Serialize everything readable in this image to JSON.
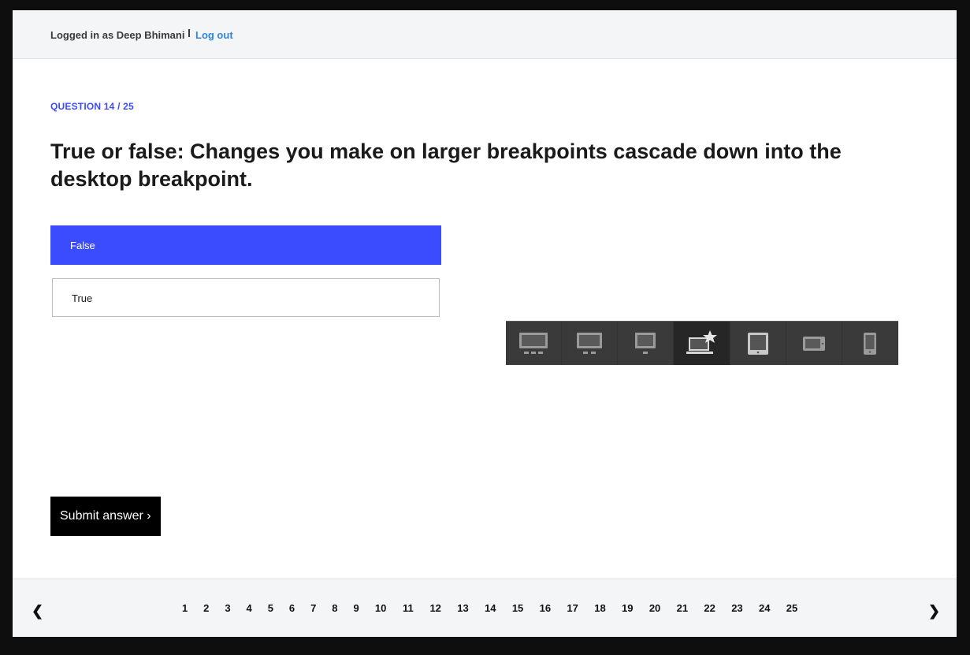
{
  "header": {
    "logged_in_text": "Logged in as Deep Bhimani",
    "logout_label": "Log out"
  },
  "quiz": {
    "counter": "QUESTION 14 / 25",
    "question": "True or false: Changes you make on larger breakpoints cascade down into the desktop breakpoint.",
    "answers": [
      {
        "label": "False",
        "selected": true
      },
      {
        "label": "True",
        "selected": false
      }
    ],
    "submit_label": "Submit answer ›"
  },
  "breakpoint_toolbar": {
    "items": [
      {
        "icon": "large-desktop-icon",
        "active": false
      },
      {
        "icon": "medium-desktop-icon",
        "active": false
      },
      {
        "icon": "small-desktop-icon",
        "active": false
      },
      {
        "icon": "desktop-base-star-icon",
        "active": true
      },
      {
        "icon": "tablet-icon",
        "active": false
      },
      {
        "icon": "mobile-landscape-icon",
        "active": false
      },
      {
        "icon": "mobile-portrait-icon",
        "active": false
      }
    ]
  },
  "pagination": {
    "prev_label": "❮",
    "next_label": "❯",
    "pages": [
      "1",
      "2",
      "3",
      "4",
      "5",
      "6",
      "7",
      "8",
      "9",
      "10",
      "11",
      "12",
      "13",
      "14",
      "15",
      "16",
      "17",
      "18",
      "19",
      "20",
      "21",
      "22",
      "23",
      "24",
      "25"
    ]
  },
  "colors": {
    "accent": "#3b4cff",
    "link": "#2e86de",
    "submit_bg": "#000000"
  }
}
